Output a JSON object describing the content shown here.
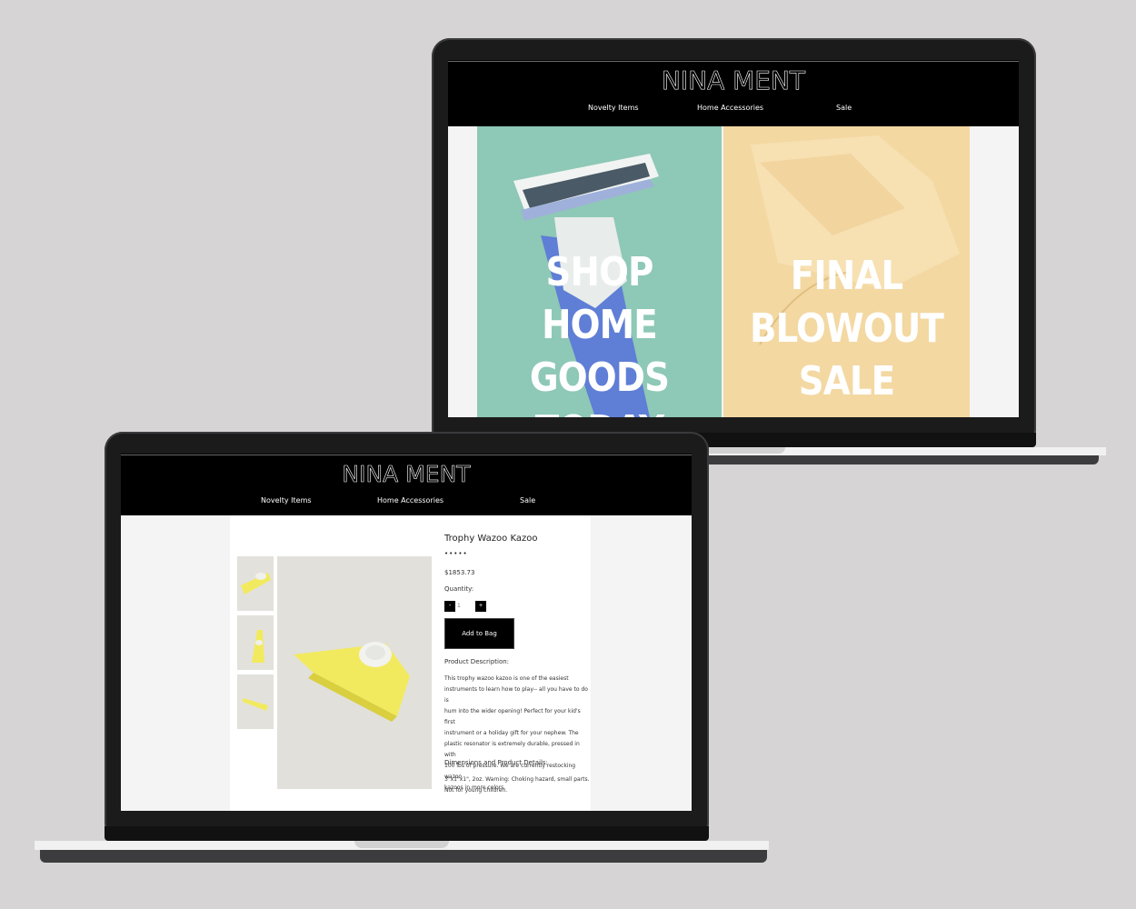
{
  "site": {
    "logo": "NINA MENT",
    "nav": [
      "Novelty Items",
      "Home Accessories",
      "Sale"
    ]
  },
  "home": {
    "tiles": [
      {
        "text_lines": [
          "SHOP",
          "HOME",
          "GOODS",
          "TODAY"
        ],
        "bg": "#8cc9b6"
      },
      {
        "text_lines": [
          "FINAL",
          "BLOWOUT",
          "SALE"
        ],
        "bg": "#f3d79f"
      }
    ]
  },
  "product": {
    "title": "Trophy Wazoo Kazoo",
    "rating": "•••••",
    "price": "$1853.73",
    "quantity_label": "Quantity:",
    "quantity_value": "1",
    "minus": "-",
    "plus": "+",
    "add_to_bag": "Add to Bag",
    "description_heading": "Product Description:",
    "description_lines": [
      "This trophy wazoo kazoo is one of the easiest",
      "instruments to learn how to play-- all you have to do is",
      "hum into the wider opening! Perfect for your kid's first",
      "instrument or a holiday gift for your nephew. The",
      "plastic resonator is extremely durable, pressed in with",
      "100 lbs of pressure. We are currently restocking wazoo",
      "kazoos in more colors."
    ],
    "dimensions_heading": "Dimensions and Product Details:",
    "dimensions_lines": [
      "3\"x1\"x1\", 2oz. Warning: Choking hazard, small parts.",
      "Not for young children."
    ]
  },
  "colors": {
    "header": "#000000",
    "page_bg": "#d6d4d5",
    "side_bg": "#f4f4f4",
    "kazoo": "#f2ea5e"
  }
}
